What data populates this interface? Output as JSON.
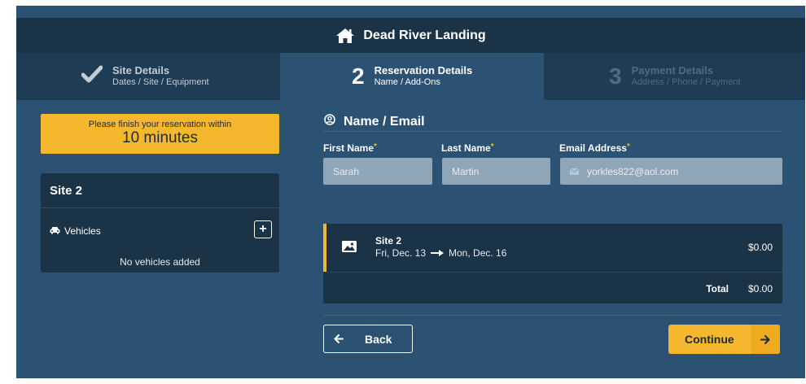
{
  "header": {
    "title": "Dead River Landing",
    "icon": "home-icon"
  },
  "steps": [
    {
      "number": "",
      "icon": "check-icon",
      "title": "Site Details",
      "subtitle": "Dates / Site / Equipment",
      "state": "completed"
    },
    {
      "number": "2",
      "title": "Reservation Details",
      "subtitle": "Name / Add-Ons",
      "state": "active"
    },
    {
      "number": "3",
      "title": "Payment Details",
      "subtitle": "Address / Phone / Payment",
      "state": "upcoming"
    }
  ],
  "timer": {
    "line1": "Please finish your reservation within",
    "line2": "10 minutes"
  },
  "site_card": {
    "title": "Site 2",
    "vehicles_label": "Vehicles",
    "add_label": "+",
    "empty_text": "No vehicles added"
  },
  "form": {
    "section_title": "Name / Email",
    "first_name": {
      "label": "First Name",
      "required": "*",
      "value": "Sarah"
    },
    "last_name": {
      "label": "Last Name",
      "required": "*",
      "value": "Martin"
    },
    "email": {
      "label": "Email Address",
      "required": "*",
      "value": "yorkles822@aol.com"
    }
  },
  "summary": {
    "site": "Site 2",
    "start_date": "Fri, Dec. 13",
    "end_date": "Mon, Dec. 16",
    "price": "$0.00",
    "total_label": "Total",
    "total_value": "$0.00"
  },
  "buttons": {
    "back": "Back",
    "continue": "Continue"
  },
  "colors": {
    "panel": "#2b5273",
    "dark": "#1b3346",
    "accent": "#f5b72e"
  }
}
